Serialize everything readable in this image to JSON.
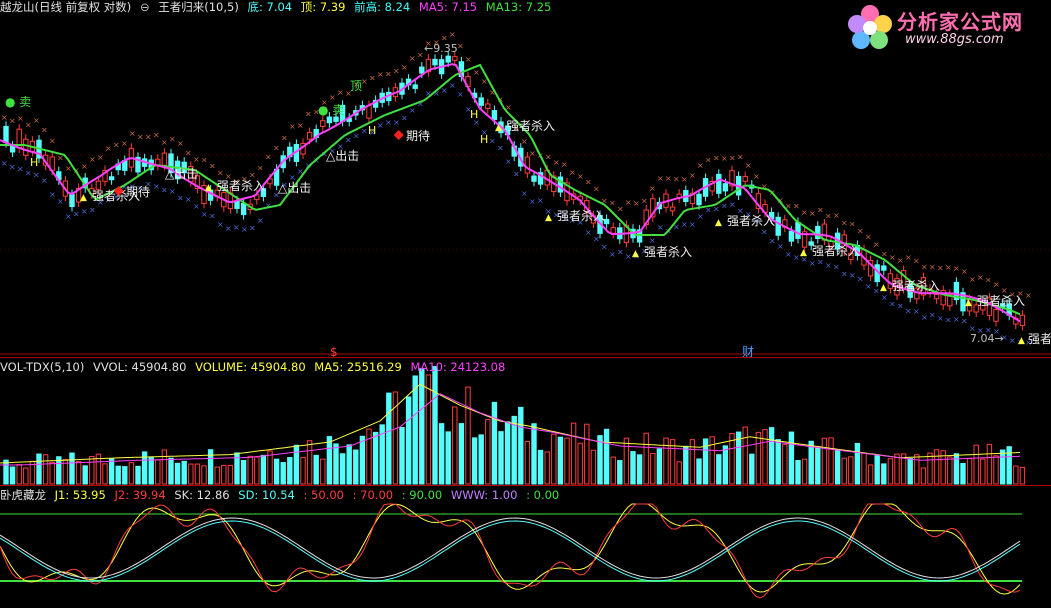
{
  "header": {
    "stock": "越龙山(日线 前复权 对数)",
    "indicator": "王者归来(10,5)",
    "low_label": "底:",
    "low_value": "7.04",
    "top_label": "顶:",
    "top_value": "7.39",
    "prev_high_label": "前高:",
    "prev_high_value": "8.24",
    "ma5_label": "MA5:",
    "ma5_value": "7.15",
    "ma13_label": "MA13:",
    "ma13_value": "7.25"
  },
  "logo": {
    "title": "分析家公式网",
    "url": "www.88gs.com"
  },
  "price_labels": {
    "sell": "卖",
    "top": "顶",
    "sell_signal": "● 卖",
    "strong_kill": "强者杀入",
    "expect": "期待",
    "exit": "△出击",
    "h": "H",
    "peak": "9.35",
    "low_marker": "7.04",
    "strong_edge": "强者",
    "dollar": "$",
    "cai": "财"
  },
  "volume_header": {
    "name": "VOL-TDX(5,10)",
    "vvol": "VVOL: 45904.80",
    "volume": "VOLUME: 45904.80",
    "ma5": "MA5: 25516.29",
    "ma10": "MA10: 24123.08"
  },
  "kd_header": {
    "name": "卧虎藏龙",
    "j1": "J1: 53.95",
    "j2": "J2: 39.94",
    "sk": "SK: 12.86",
    "sd": "SD: 10.54",
    "l50": ": 50.00",
    "l70": ": 70.00",
    "l90": ": 90.00",
    "www": "WWW: 1.00",
    "zero": ": 0.00"
  },
  "colors": {
    "up": "#ff3c3c",
    "down": "#54fcfc",
    "ma_fast": "#ff40ff",
    "ma_slow": "#40e040",
    "signal": "#ffff40",
    "grid": "#b00000"
  }
}
